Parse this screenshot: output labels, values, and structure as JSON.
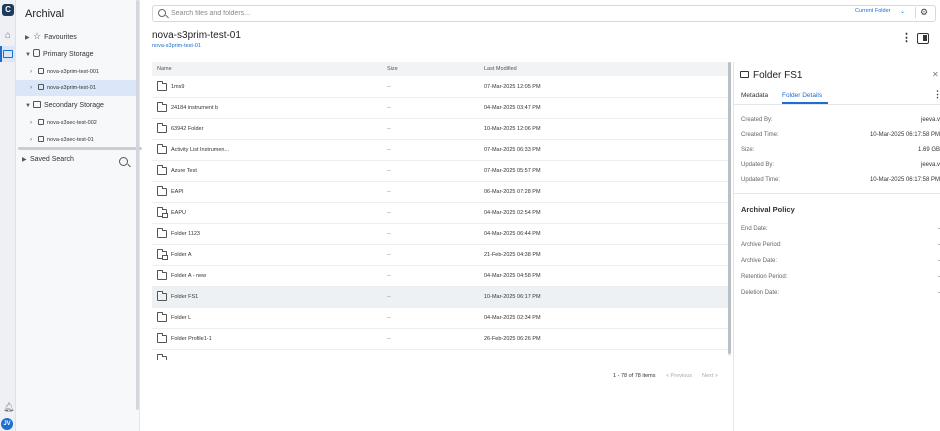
{
  "rail": {
    "logo_text": "C",
    "avatar_initials": "JV"
  },
  "nav": {
    "title": "Archival",
    "favourites": "Favourites",
    "primary_storage": "Primary Storage",
    "primary_buckets": [
      "nova-s3prim-test-001",
      "nova-s3prim-test-01"
    ],
    "secondary_storage": "Secondary Storage",
    "secondary_buckets": [
      "nova-s3sec-test-002",
      "nova-s3sec-test-01"
    ],
    "saved_search": "Saved Search"
  },
  "search": {
    "placeholder": "Search files and folders...",
    "scope": "Current Folder"
  },
  "header": {
    "title": "nova-s3prim-test-01",
    "breadcrumb": "nova-s3prim-test-01"
  },
  "table": {
    "columns": [
      "Name",
      "Size",
      "Last Modified"
    ],
    "rows": [
      {
        "name": "1ms9",
        "size": "--",
        "modified": "07-Mar-2025 12:05 PM",
        "icon": "folder-icon"
      },
      {
        "name": "24184 instrument b",
        "size": "--",
        "modified": "04-Mar-2025 03:47 PM",
        "icon": "folder-icon"
      },
      {
        "name": "63942 Folder",
        "size": "--",
        "modified": "10-Mar-2025 12:06 PM",
        "icon": "folder-icon"
      },
      {
        "name": "Activity List Instrumen...",
        "size": "--",
        "modified": "07-Mar-2025 06:33 PM",
        "icon": "folder-icon"
      },
      {
        "name": "Azure Test",
        "size": "--",
        "modified": "07-Mar-2025 05:57 PM",
        "icon": "folder-icon"
      },
      {
        "name": "EAPI",
        "size": "--",
        "modified": "06-Mar-2025 07:28 PM",
        "icon": "folder-icon"
      },
      {
        "name": "EAPU",
        "size": "--",
        "modified": "04-Mar-2025 02:54 PM",
        "icon": "locked-folder-icon"
      },
      {
        "name": "Folder 1123",
        "size": "--",
        "modified": "04-Mar-2025 06:44 PM",
        "icon": "folder-icon"
      },
      {
        "name": "Folder A",
        "size": "--",
        "modified": "21-Feb-2025 04:38 PM",
        "icon": "locked-folder-icon"
      },
      {
        "name": "Folder A - new",
        "size": "--",
        "modified": "04-Mar-2025 04:58 PM",
        "icon": "folder-icon"
      },
      {
        "name": "Folder FS1",
        "size": "--",
        "modified": "10-Mar-2025 06:17 PM",
        "icon": "folder-icon"
      },
      {
        "name": "Folder L",
        "size": "--",
        "modified": "04-Mar-2025 02:34 PM",
        "icon": "folder-icon"
      },
      {
        "name": "Folder Profile1-1",
        "size": "--",
        "modified": "26-Feb-2025 06:26 PM",
        "icon": "folder-icon"
      }
    ],
    "selected_row": "Folder FS1"
  },
  "pager": {
    "count": "1 - 78 of 78 items",
    "prev": "< Previous",
    "next": "Next >"
  },
  "details": {
    "title": "Folder FS1",
    "tabs": [
      "Metadata",
      "Folder Details"
    ],
    "active_tab": "Folder Details",
    "fields": [
      {
        "label": "Created By:",
        "value": "jeeva.v"
      },
      {
        "label": "Created Time:",
        "value": "10-Mar-2025 06:17:58 PM"
      },
      {
        "label": "Size:",
        "value": "1.69 GB"
      },
      {
        "label": "Updated By:",
        "value": "jeeva.v"
      },
      {
        "label": "Updated Time:",
        "value": "10-Mar-2025 06:17:58 PM"
      }
    ],
    "policy_title": "Archival Policy",
    "policy_fields": [
      {
        "label": "End Date:",
        "value": "-"
      },
      {
        "label": "Archive Period:",
        "value": "-"
      },
      {
        "label": "Archive Date:",
        "value": "-"
      },
      {
        "label": "Retention Period:",
        "value": "-"
      },
      {
        "label": "Deletion Date:",
        "value": "-"
      }
    ]
  },
  "colors": {
    "accent": "#1a6fd1",
    "selection": "#dbe7f8"
  }
}
